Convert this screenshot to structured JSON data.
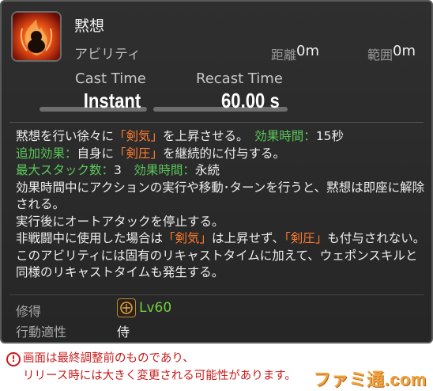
{
  "action": {
    "name": "黙想",
    "type": "アビリティ",
    "range_label": "距離",
    "range_value": "0m",
    "radius_label": "範囲",
    "radius_value": "0m",
    "cast_label": "Cast Time",
    "cast_value": "Instant",
    "recast_label": "Recast Time",
    "recast_value": "60.00 s",
    "icon": "meditate-flame-icon"
  },
  "description": {
    "line1_a": "黙想を行い徐々に",
    "line1_b": "「剣気」",
    "line1_c": "を上昇させる。　",
    "line1_d": "効果時間：",
    "line1_e": "15秒",
    "line2_a": "追加効果：",
    "line2_b": "自身に",
    "line2_c": "「剣圧」",
    "line2_d": "を継続的に付与する。",
    "line3_a": "最大スタック数：",
    "line3_b": "3　",
    "line3_c": "効果時間：",
    "line3_d": "永続",
    "line4": "効果時間中にアクションの実行や移動･ターンを行うと、黙想は即座に解除される。",
    "line5": "実行後にオートアタックを停止する。",
    "line6_a": "非戦闘中に使用した場合は",
    "line6_b": "「剣気」",
    "line6_c": "は上昇せず、",
    "line6_d": "「剣圧」",
    "line6_e": "も付与されない。",
    "line7": "このアビリティには固有のリキャストタイムに加えて、ウェポンスキルと同様のリキャストタイムも発生する。"
  },
  "requirements": {
    "acquired_label": "修得",
    "level": "Lv60",
    "job_icon": "samurai-job-icon",
    "class_label": "行動適性",
    "class_value": "侍"
  },
  "notice": {
    "line1": "画面は最終調整前のものであり、",
    "line2": "リリース時には大きく変更される可能性があります。"
  },
  "watermark": "ファミ通.com",
  "colors": {
    "orange": "#ff7b2e",
    "green": "#5ac85a",
    "level": "#6fcf3f",
    "notice": "#cc1a1a"
  }
}
